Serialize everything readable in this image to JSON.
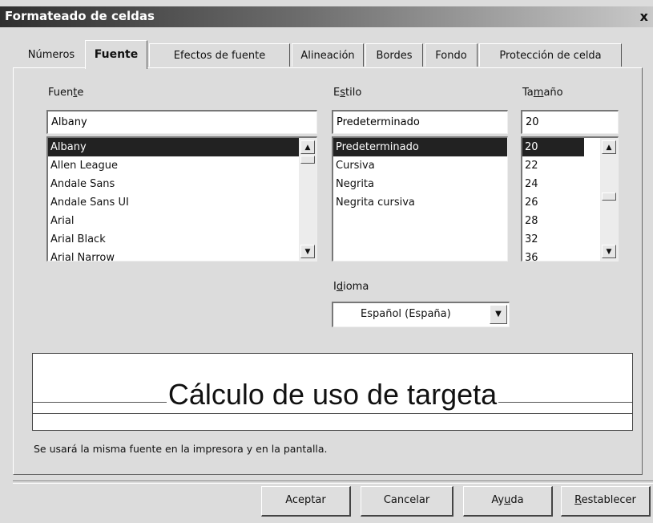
{
  "window": {
    "title": "Formateado de celdas",
    "close_glyph": "x"
  },
  "tabs": [
    {
      "label": "Números"
    },
    {
      "label": "Fuente"
    },
    {
      "label": "Efectos de fuente"
    },
    {
      "label": "Alineación"
    },
    {
      "label": "Bordes"
    },
    {
      "label": "Fondo"
    },
    {
      "label": "Protección de celda"
    }
  ],
  "active_tab": "Fuente",
  "font": {
    "label_pre": "Fuen",
    "label_accel": "t",
    "label_post": "e",
    "value": "Albany",
    "items": [
      "Albany",
      "Allen League",
      "Andale Sans",
      "Andale Sans UI",
      "Arial",
      "Arial Black",
      "Arial Narrow"
    ],
    "selected": "Albany"
  },
  "style": {
    "label_pre": "E",
    "label_accel": "s",
    "label_post": "tilo",
    "value": "Predeterminado",
    "items": [
      "Predeterminado",
      "Cursiva",
      "Negrita",
      "Negrita cursiva"
    ],
    "selected": "Predeterminado"
  },
  "size": {
    "label_pre": "Ta",
    "label_accel": "m",
    "label_post": "año",
    "value": "20",
    "items": [
      "20",
      "22",
      "24",
      "26",
      "28",
      "32",
      "36"
    ],
    "selected": "20"
  },
  "language": {
    "label_pre": "I",
    "label_accel": "d",
    "label_post": "ioma",
    "value": "Español (España)"
  },
  "preview": {
    "text": "Cálculo de uso de targeta"
  },
  "info_text": "Se usará la misma fuente en la impresora y en la pantalla.",
  "buttons": {
    "ok": "Aceptar",
    "cancel": "Cancelar",
    "help_pre": "Ay",
    "help_accel": "u",
    "help_post": "da",
    "reset_accel": "R",
    "reset_post": "establecer"
  },
  "icons": {
    "scroll_up": "▲",
    "scroll_down": "▼",
    "dropdown": "▼"
  },
  "colors": {
    "selection": "#222222",
    "dialog_bg": "#dcdcdc"
  }
}
